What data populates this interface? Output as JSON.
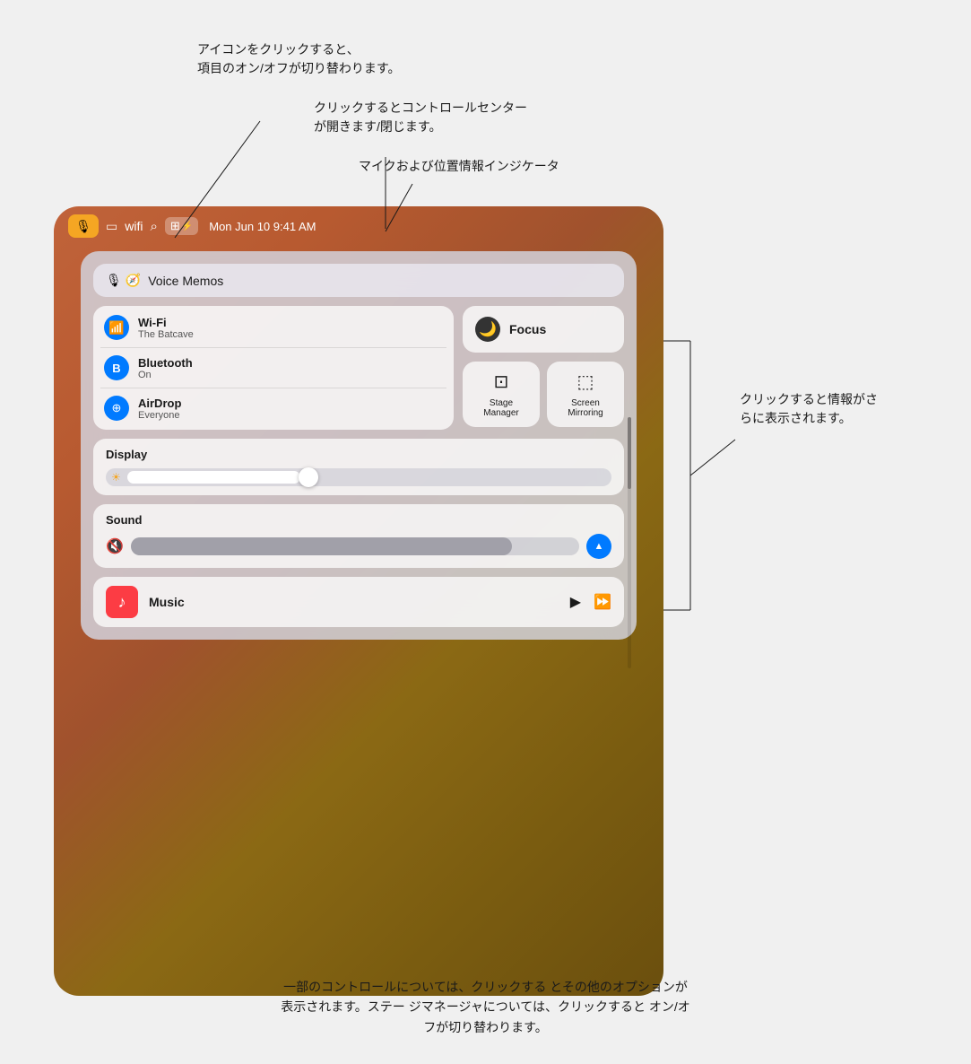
{
  "annotations": {
    "top_left": "アイコンをクリックすると、\n項目のオン/オフが切り替わります。",
    "top_right1": "クリックするとコントロールセンター\nが開きます/閉じます。",
    "top_right2": "マイクおよび位置情報インジケータ",
    "right_middle": "クリックすると情報がさ\nらに表示されます。",
    "bottom": "一部のコントロールについては、クリックする\nとその他のオプションが表示されます。ステー\nジマネージャについては、クリックすると\nオン/オフが切り替わります。"
  },
  "statusBar": {
    "time": "Mon Jun 10  9:41 AM",
    "batteryIcon": "▬",
    "wifiIcon": "⌾",
    "searchIcon": "⌕"
  },
  "controlCenter": {
    "voiceMemosLabel": "Voice Memos",
    "network": {
      "wifi": {
        "title": "Wi-Fi",
        "subtitle": "The Batcave"
      },
      "bluetooth": {
        "title": "Bluetooth",
        "subtitle": "On"
      },
      "airdrop": {
        "title": "AirDrop",
        "subtitle": "Everyone"
      }
    },
    "focus": {
      "label": "Focus"
    },
    "stageManager": {
      "label": "Stage\nManager"
    },
    "screenMirroring": {
      "label": "Screen\nMirroring"
    },
    "display": {
      "title": "Display"
    },
    "sound": {
      "title": "Sound"
    },
    "music": {
      "label": "Music"
    }
  }
}
